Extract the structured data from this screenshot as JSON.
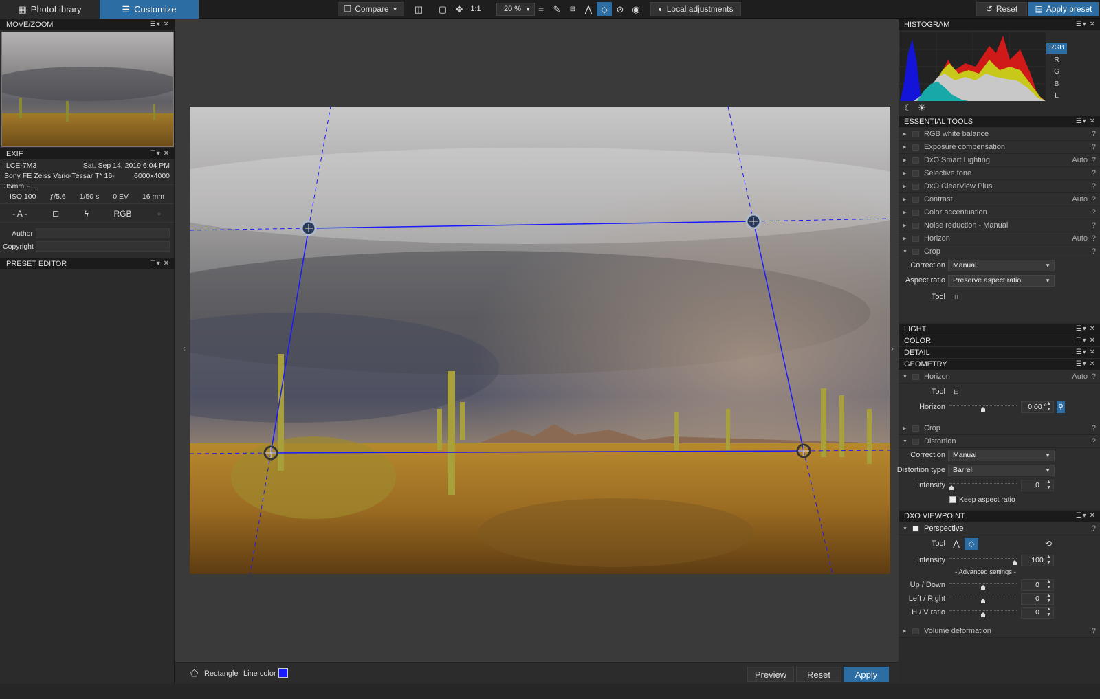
{
  "topbar": {
    "tab_photolibrary": "PhotoLibrary",
    "tab_customize": "Customize",
    "compare": "Compare",
    "zoom_1to1": "1:1",
    "zoom_level": "20 %",
    "local_adjustments": "Local adjustments",
    "reset": "Reset",
    "apply_preset": "Apply preset"
  },
  "left": {
    "move_zoom": "MOVE/ZOOM",
    "exif_title": "EXIF",
    "camera": "ILCE-7M3",
    "datetime": "Sat, Sep 14, 2019 6:04 PM",
    "lens": "Sony FE Zeiss Vario-Tessar T* 16-35mm F...",
    "resolution": "6000x4000",
    "iso": "ISO 100",
    "aperture": "ƒ/5.6",
    "shutter": "1/50 s",
    "ev": "0 EV",
    "focal": "16 mm",
    "mode": "- A -",
    "colorspace": "RGB",
    "author_label": "Author",
    "copyright_label": "Copyright",
    "preset_editor": "PRESET EDITOR"
  },
  "bottom": {
    "rectangle": "Rectangle",
    "line_color": "Line color",
    "line_color_value": "#1a1aff",
    "preview": "Preview",
    "reset": "Reset",
    "apply": "Apply"
  },
  "right": {
    "histogram": "HISTOGRAM",
    "channels": [
      "RGB",
      "R",
      "G",
      "B",
      "L"
    ],
    "essential_tools": "ESSENTIAL TOOLS",
    "tools": [
      {
        "name": "RGB white balance",
        "auto": ""
      },
      {
        "name": "Exposure compensation",
        "auto": ""
      },
      {
        "name": "DxO Smart Lighting",
        "auto": "Auto"
      },
      {
        "name": "Selective tone",
        "auto": ""
      },
      {
        "name": "DxO ClearView Plus",
        "auto": ""
      },
      {
        "name": "Contrast",
        "auto": "Auto"
      },
      {
        "name": "Color accentuation",
        "auto": ""
      },
      {
        "name": "Noise reduction - Manual",
        "auto": ""
      },
      {
        "name": "Horizon",
        "auto": "Auto"
      },
      {
        "name": "Crop",
        "auto": ""
      }
    ],
    "crop_correction_label": "Correction",
    "crop_correction_value": "Manual",
    "aspect_ratio_label": "Aspect ratio",
    "aspect_ratio_value": "Preserve aspect ratio",
    "tool_label": "Tool",
    "light": "LIGHT",
    "color": "COLOR",
    "detail": "DETAIL",
    "geometry": "GEOMETRY",
    "geo_horizon": "Horizon",
    "geo_horizon_auto": "Auto",
    "horizon_label": "Horizon",
    "horizon_value": "0.00 °",
    "geo_crop": "Crop",
    "geo_distortion": "Distortion",
    "dist_correction_label": "Correction",
    "dist_correction_value": "Manual",
    "dist_type_label": "Distortion type",
    "dist_type_value": "Barrel",
    "intensity_label": "Intensity",
    "dist_intensity_value": "0",
    "keep_aspect": "Keep aspect ratio",
    "viewpoint": "DXO VIEWPOINT",
    "perspective": "Perspective",
    "persp_intensity_value": "100",
    "advanced": "- Advanced settings -",
    "updown_label": "Up / Down",
    "updown_value": "0",
    "leftright_label": "Left / Right",
    "leftright_value": "0",
    "hv_label": "H / V ratio",
    "hv_value": "0",
    "volume_deformation": "Volume deformation",
    "q": "?"
  },
  "colors": {
    "accent": "#2c6ea3",
    "guide_line": "#1a1aff"
  }
}
